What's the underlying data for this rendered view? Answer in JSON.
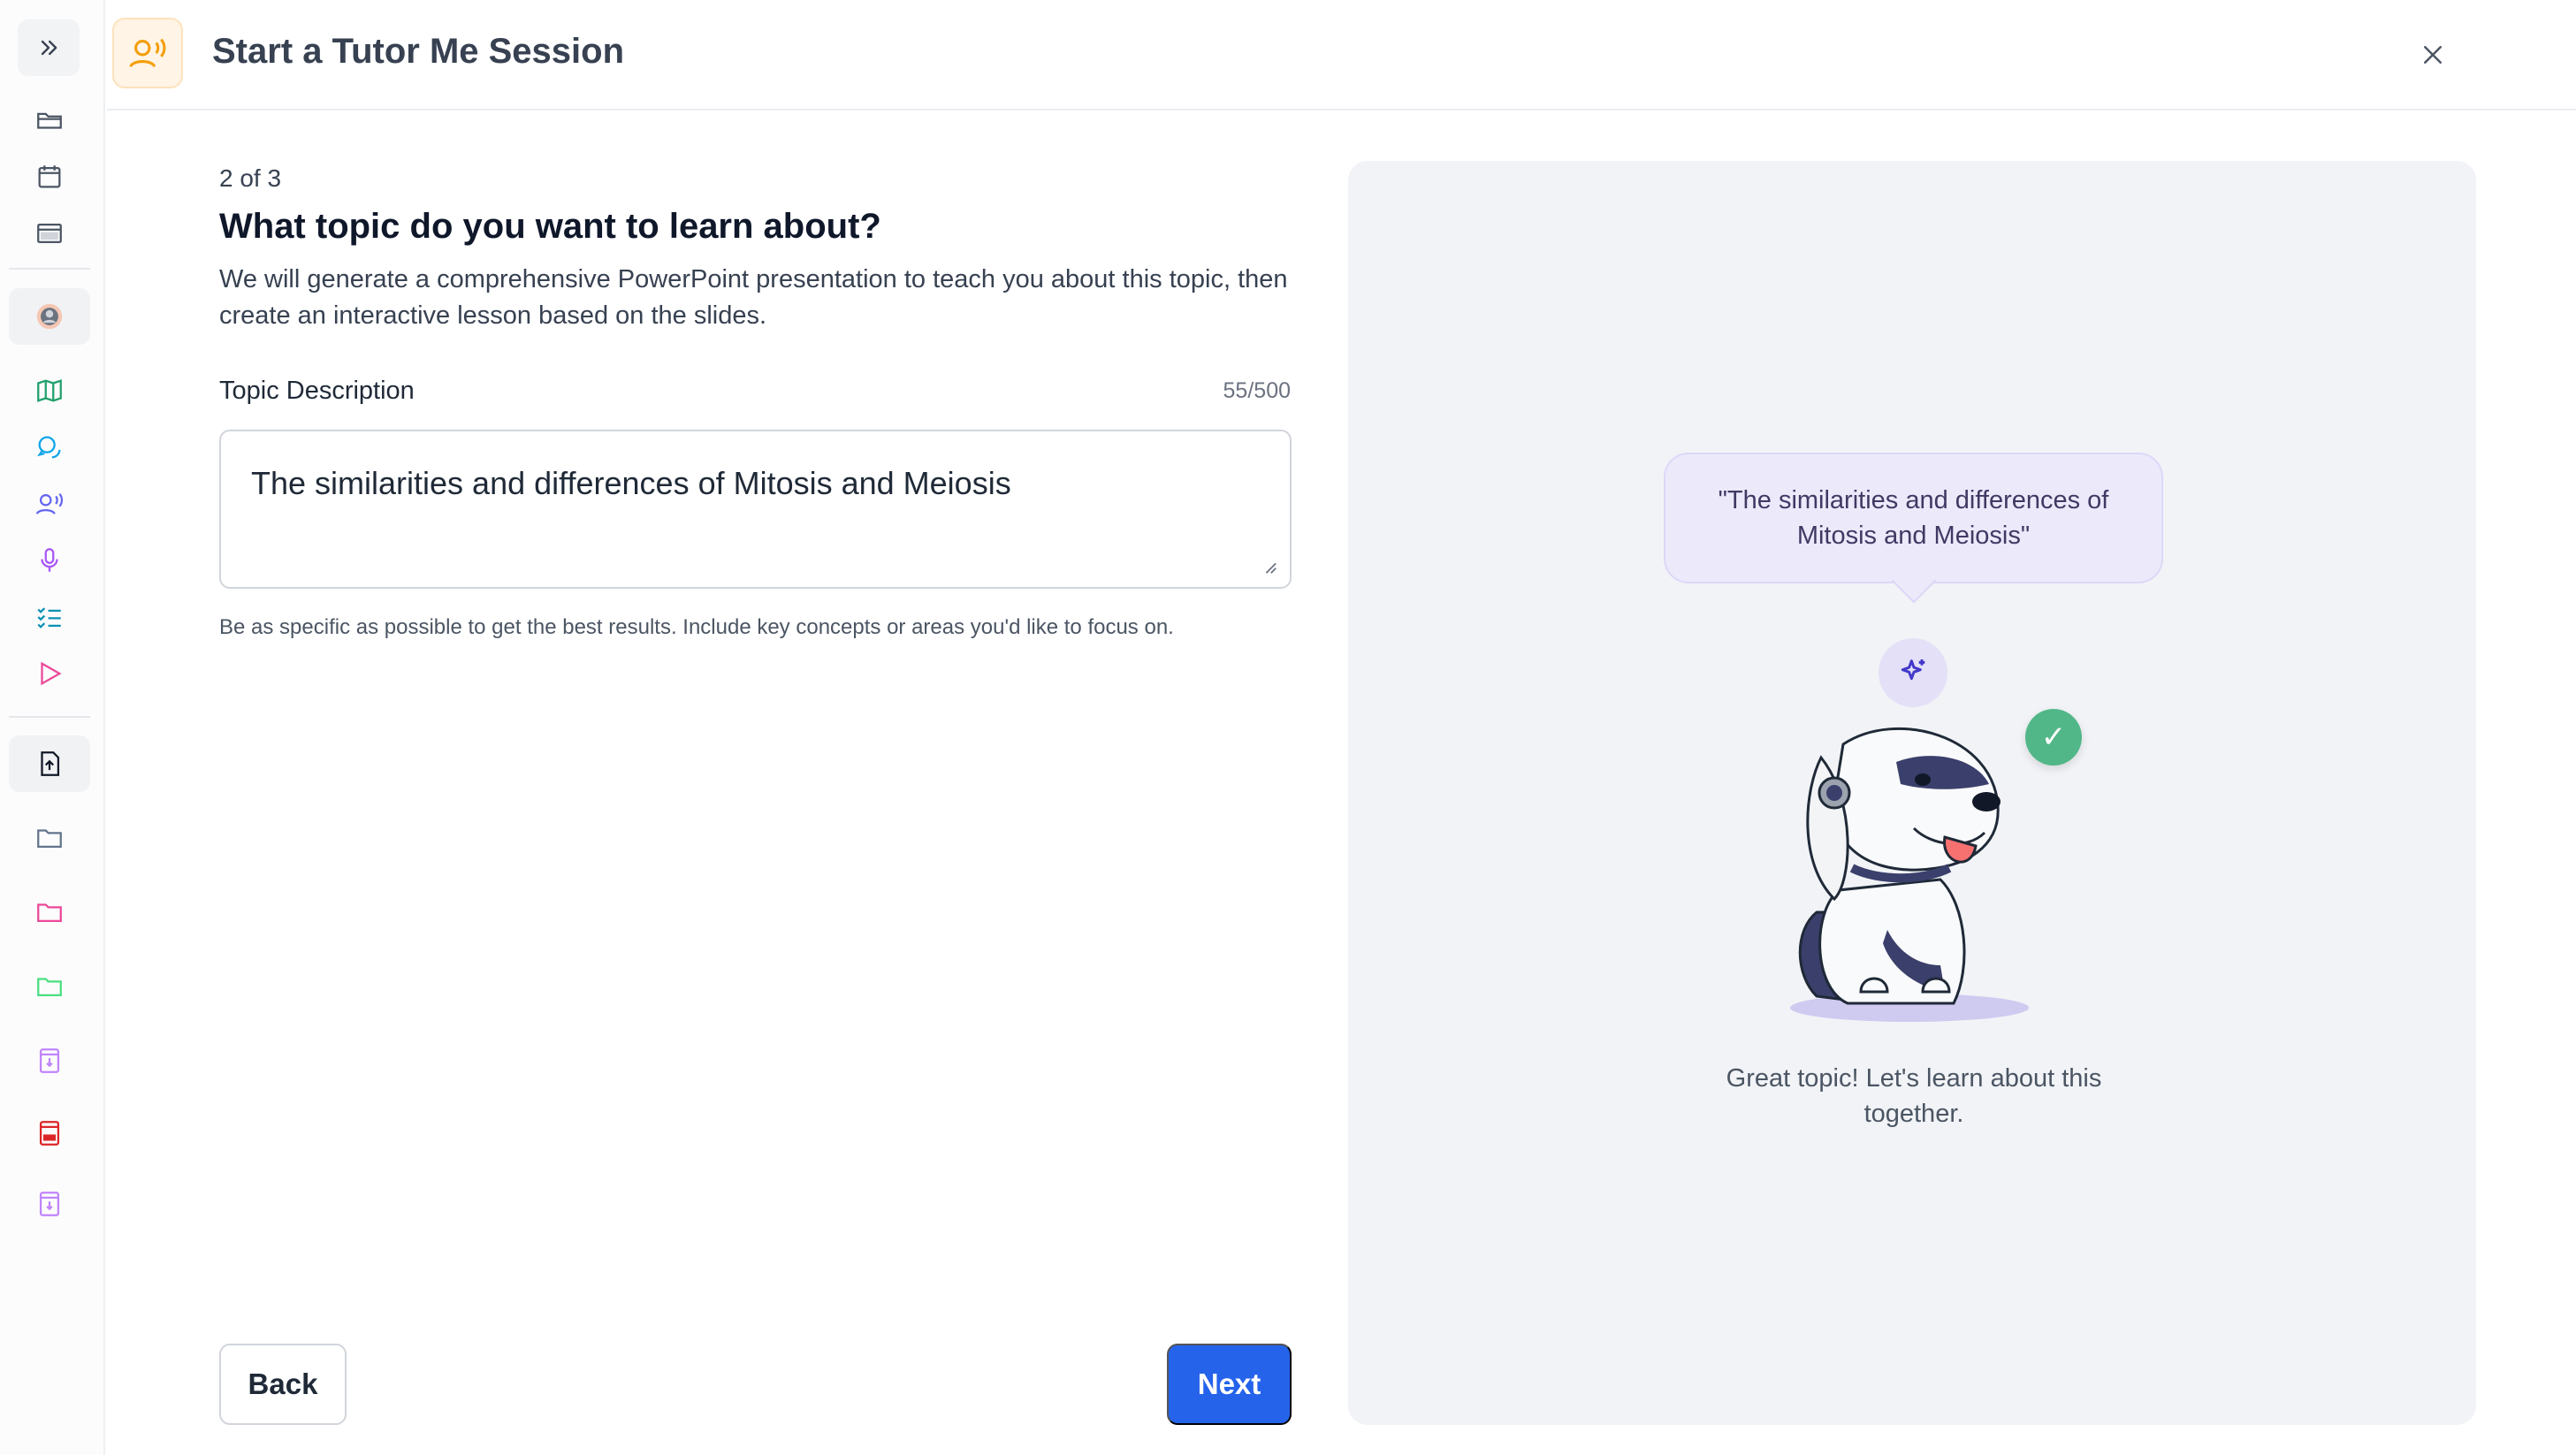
{
  "header": {
    "title": "Start a Tutor Me Session"
  },
  "sidebar": {
    "items": [
      {
        "icon": "folder-open-icon"
      },
      {
        "icon": "calendar-icon"
      },
      {
        "icon": "window-icon"
      },
      {
        "icon": "avatar-icon"
      },
      {
        "icon": "map-icon"
      },
      {
        "icon": "chat-icon"
      },
      {
        "icon": "tutor-voice-icon"
      },
      {
        "icon": "microphone-icon"
      },
      {
        "icon": "checklist-icon"
      },
      {
        "icon": "play-icon"
      },
      {
        "icon": "file-upload-icon"
      },
      {
        "icon": "folder-icon"
      },
      {
        "icon": "folder-pink-icon"
      },
      {
        "icon": "folder-green-icon"
      },
      {
        "icon": "audio-file-icon"
      },
      {
        "icon": "pdf-file-icon"
      },
      {
        "icon": "audio-file-icon"
      }
    ]
  },
  "form": {
    "step": "2 of 3",
    "question": "What topic do you want to learn about?",
    "description": "We will generate a comprehensive PowerPoint presentation to teach you about this topic, then create an interactive lesson based on the slides.",
    "field_label": "Topic Description",
    "counter": "55/500",
    "topic_value": "The similarities and differences of Mitosis and Meiosis",
    "hint": "Be as specific as possible to get the best results. Include key concepts or areas you'd like to focus on.",
    "back_label": "Back",
    "next_label": "Next"
  },
  "preview": {
    "bubble_text": "\"The similarities and differences of Mitosis and Meiosis\"",
    "check_mark": "✓",
    "caption": "Great topic! Let's learn about this together."
  },
  "colors": {
    "primary": "#2563eb",
    "panel_bg": "#f1f3f7",
    "bubble_bg": "#ece9fb",
    "success": "#52b788",
    "header_icon_bg": "#fff4e5"
  }
}
